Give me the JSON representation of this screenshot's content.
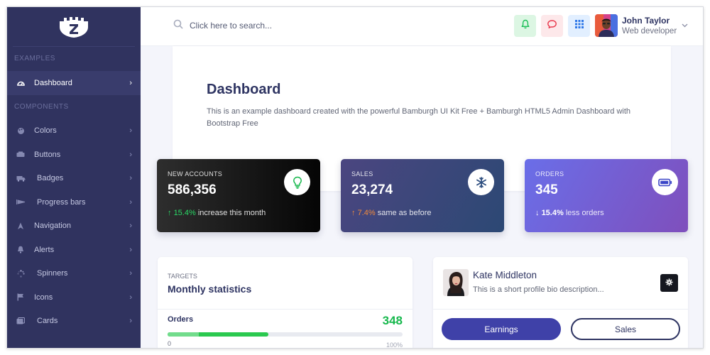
{
  "sidebar": {
    "sections": [
      {
        "label": "EXAMPLES"
      },
      {
        "label": "COMPONENTS"
      }
    ],
    "items": [
      {
        "label": "Dashboard",
        "icon": "dashboard-icon"
      },
      {
        "label": "Colors",
        "icon": "palette-icon"
      },
      {
        "label": "Buttons",
        "icon": "buttons-icon"
      },
      {
        "label": "Badges",
        "icon": "truck-icon"
      },
      {
        "label": "Progress bars",
        "icon": "progress-icon"
      },
      {
        "label": "Navigation",
        "icon": "navigation-icon"
      },
      {
        "label": "Alerts",
        "icon": "bell-icon"
      },
      {
        "label": "Spinners",
        "icon": "spinner-icon"
      },
      {
        "label": "Icons",
        "icon": "flag-icon"
      },
      {
        "label": "Cards",
        "icon": "cards-icon"
      }
    ]
  },
  "header": {
    "search_placeholder": "Click here to search...",
    "user": {
      "name": "John Taylor",
      "role": "Web developer"
    }
  },
  "hero": {
    "title": "Dashboard",
    "text": "This is an example dashboard created with the powerful Bamburgh UI Kit Free + Bamburgh HTML5 Admin Dashboard with Bootstrap Free"
  },
  "stats": [
    {
      "label": "NEW ACCOUNTS",
      "value": "586,356",
      "change": "15.4%",
      "note": "increase this month",
      "icon": "lightbulb-icon"
    },
    {
      "label": "SALES",
      "value": "23,274",
      "change": "7.4%",
      "note": "same as before",
      "icon": "snowflake-icon"
    },
    {
      "label": "ORDERS",
      "value": "345",
      "change": "15.4%",
      "note": "less orders",
      "icon": "battery-icon"
    }
  ],
  "targets": {
    "overline": "TARGETS",
    "title": "Monthly statistics",
    "orders_label": "Orders",
    "orders_count": "348",
    "progress_percent": 43,
    "min_label": "0",
    "max_label": "100%"
  },
  "profile": {
    "name": "Kate Middleton",
    "bio": "This is a short profile bio description...",
    "earnings_label": "Earnings",
    "sales_label": "Sales"
  },
  "colors": {
    "sidebar": "#30335f",
    "primary": "#3f41a8",
    "success": "#17b84d",
    "warning": "#f08a3c"
  }
}
